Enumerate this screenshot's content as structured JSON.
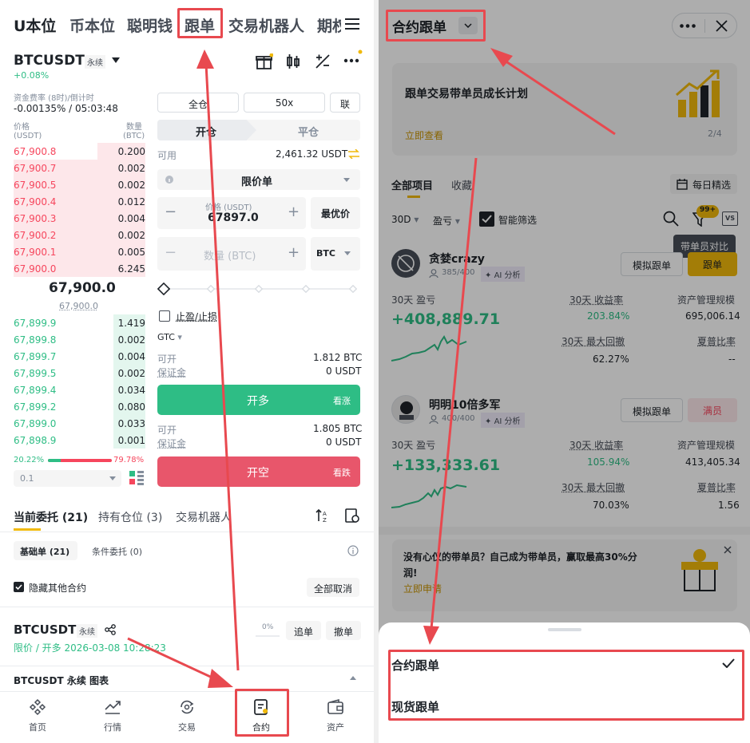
{
  "left": {
    "tabs": [
      "U本位",
      "币本位",
      "聪明钱",
      "跟单",
      "交易机器人",
      "期权"
    ],
    "symbol": "BTCUSDT",
    "symbol_tag": "永续",
    "change": "+0.08%",
    "funding_label": "资金费率 (8时)/倒计时",
    "funding_value": "-0.00135% / 05:03:48",
    "ob_price_label": "价格",
    "ob_price_unit": "(USDT)",
    "ob_qty_label": "数量",
    "ob_qty_unit": "(BTC)",
    "asks": [
      {
        "price": "67,900.8",
        "qty": "0.200"
      },
      {
        "price": "67,900.7",
        "qty": "0.002"
      },
      {
        "price": "67,900.5",
        "qty": "0.002"
      },
      {
        "price": "67,900.4",
        "qty": "0.012"
      },
      {
        "price": "67,900.3",
        "qty": "0.004"
      },
      {
        "price": "67,900.2",
        "qty": "0.002"
      },
      {
        "price": "67,900.1",
        "qty": "0.005"
      },
      {
        "price": "67,900.0",
        "qty": "6.245"
      }
    ],
    "mid_price": "67,900.0",
    "mark_price": "67,900.0",
    "bids": [
      {
        "price": "67,899.9",
        "qty": "1.419"
      },
      {
        "price": "67,899.8",
        "qty": "0.002"
      },
      {
        "price": "67,899.7",
        "qty": "0.004"
      },
      {
        "price": "67,899.5",
        "qty": "0.002"
      },
      {
        "price": "67,899.4",
        "qty": "0.034"
      },
      {
        "price": "67,899.2",
        "qty": "0.080"
      },
      {
        "price": "67,899.0",
        "qty": "0.033"
      },
      {
        "price": "67,898.9",
        "qty": "0.001"
      }
    ],
    "bid_pct": "20.22%",
    "ask_pct": "79.78%",
    "bid_share": 0.2022,
    "depth_step": "0.1",
    "margin_mode": "全仓",
    "leverage": "50x",
    "unified": "联",
    "open_tab": "开仓",
    "close_tab": "平仓",
    "available_label": "可用",
    "available_value": "2,461.32 USDT",
    "order_type": "限价单",
    "price_label": "价格 (USDT)",
    "price_value": "67897.0",
    "best_price": "最优价",
    "qty_placeholder": "数量 (BTC)",
    "qty_unit": "BTC",
    "tpsl_label": "止盈/止损",
    "tif": "GTC",
    "long_avail_label": "可开",
    "long_avail_value": "1.812 BTC",
    "long_margin_label": "保证金",
    "long_margin_value": "0 USDT",
    "long_button": "开多",
    "long_hint": "看涨",
    "short_avail_label": "可开",
    "short_avail_value": "1.805 BTC",
    "short_margin_label": "保证金",
    "short_margin_value": "0 USDT",
    "short_button": "开空",
    "short_hint": "看跌",
    "bottom_tabs": [
      "当前委托 (21)",
      "持有仓位 (3)",
      "交易机器人"
    ],
    "subtab_basic": "基础单 (21)",
    "subtab_cond": "条件委托 (0)",
    "hide_other": "隐藏其他合约",
    "cancel_all": "全部取消",
    "order_symbol": "BTCUSDT",
    "order_tag": "永续",
    "order_info": "限价 / 开多  2026-03-08 10:28:23",
    "order_pct": "0%",
    "chase": "追单",
    "cancel": "撤单",
    "chart_bar": "BTCUSDT 永续 图表",
    "nav": [
      "首页",
      "行情",
      "交易",
      "合约",
      "资产"
    ]
  },
  "right": {
    "title": "合约跟单",
    "banner_text": "跟单交易带单员成长计划",
    "banner_link": "立即查看",
    "banner_page": "2/4",
    "tab_all": "全部项目",
    "tab_fav": "收藏",
    "daily": "每日精选",
    "filter_period": "30D",
    "filter_sort": "盈亏",
    "smart_filter": "智能筛选",
    "badge": "99+",
    "compare_tip": "带单员对比",
    "vs": "VS",
    "traders": [
      {
        "name": "贪婪crazy",
        "followers": "385/400",
        "ai": "AI 分析",
        "sim": "模拟跟单",
        "action": "跟单",
        "pnl_label": "30天 盈亏",
        "pnl": "+408,889.71",
        "roi_label": "30天 收益率",
        "roi": "203.84%",
        "aum_label": "资产管理规模",
        "aum": "695,006.14",
        "mdd_label": "30天 最大回撤",
        "mdd": "62.27%",
        "sharpe_label": "夏普比率",
        "sharpe": "--"
      },
      {
        "name": "明明10倍多军",
        "followers": "400/400",
        "ai": "AI 分析",
        "sim": "模拟跟单",
        "action": "满员",
        "pnl_label": "30天 盈亏",
        "pnl": "+133,333.61",
        "roi_label": "30天 收益率",
        "roi": "105.94%",
        "aum_label": "资产管理规模",
        "aum": "413,405.34",
        "mdd_label": "30天 最大回撤",
        "mdd": "70.03%",
        "sharpe_label": "夏普比率",
        "sharpe": "1.56"
      }
    ],
    "promo_text": "没有心仪的带单员？自己成为带单员，赢取最高30%分润!",
    "promo_link": "立即申请",
    "sheet_option1": "合约跟单",
    "sheet_option2": "现货跟单",
    "colors": {
      "accent": "#f0b90b",
      "green": "#2ebd85",
      "red": "#f6465d",
      "annotation": "#e8494f"
    }
  }
}
